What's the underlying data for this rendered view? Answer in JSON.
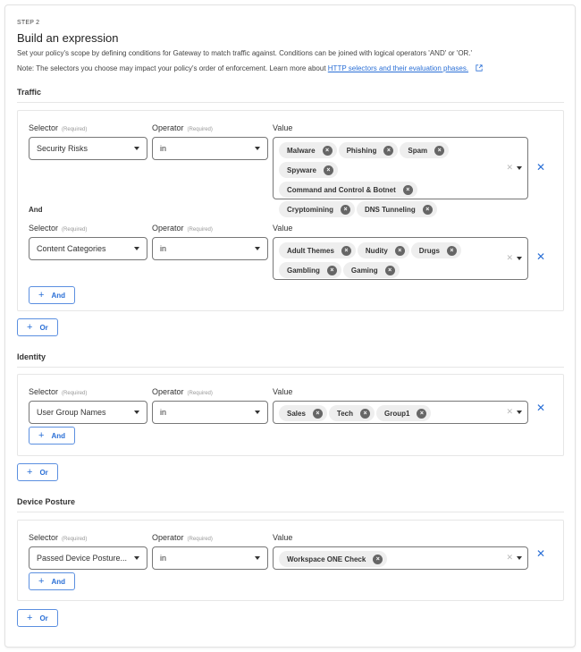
{
  "header": {
    "step": "STEP 2",
    "title": "Build an expression",
    "description": "Set your policy's scope by defining conditions for Gateway to match traffic against. Conditions can be joined with logical operators 'AND' or 'OR.'",
    "note_prefix": "Note: The selectors you choose may impact your policy's order of enforcement. Learn more about ",
    "note_link": "HTTP selectors and their evaluation phases."
  },
  "labels": {
    "selector": "Selector",
    "operator": "Operator",
    "value": "Value",
    "required": "(Required)",
    "and_joiner": "And",
    "add_and": "And",
    "add_or": "Or",
    "plus": "+",
    "remove": "✕",
    "chip_remove": "×",
    "clear": "✕"
  },
  "sections": [
    {
      "title": "Traffic",
      "conditions": [
        {
          "selector": "Security Risks",
          "operator": "in",
          "values": [
            "Malware",
            "Phishing",
            "Spam",
            "Spyware",
            "Command and Control & Botnet",
            "Cryptomining",
            "DNS Tunneling"
          ]
        },
        {
          "selector": "Content Categories",
          "operator": "in",
          "values": [
            "Adult Themes",
            "Nudity",
            "Drugs",
            "Gambling",
            "Gaming"
          ]
        }
      ]
    },
    {
      "title": "Identity",
      "conditions": [
        {
          "selector": "User Group Names",
          "operator": "in",
          "values": [
            "Sales",
            "Tech",
            "Group1"
          ]
        }
      ]
    },
    {
      "title": "Device Posture",
      "conditions": [
        {
          "selector": "Passed Device Posture...",
          "operator": "in",
          "values": [
            "Workspace ONE Check"
          ]
        }
      ]
    }
  ],
  "colors": {
    "accent": "#2a6fd6",
    "chip_bg": "#eeeeee",
    "chip_remove_bg": "#666666"
  }
}
